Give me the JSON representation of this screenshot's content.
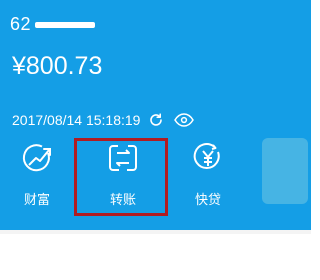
{
  "account": {
    "number": "62"
  },
  "balance": {
    "amount": "¥800.73"
  },
  "timestamp": {
    "text": "2017/08/14 15:18:19",
    "refresh_icon": "refresh-icon",
    "visibility_icon": "eye-icon"
  },
  "actions": [
    {
      "label": "财富",
      "icon": "chart-growth-icon"
    },
    {
      "label": "转账",
      "icon": "transfer-icon"
    },
    {
      "label": "快贷",
      "icon": "loan-yen-icon"
    }
  ],
  "colors": {
    "card": "#149ee6",
    "highlight": "#b01c22",
    "panel": "#4fb7e3"
  }
}
